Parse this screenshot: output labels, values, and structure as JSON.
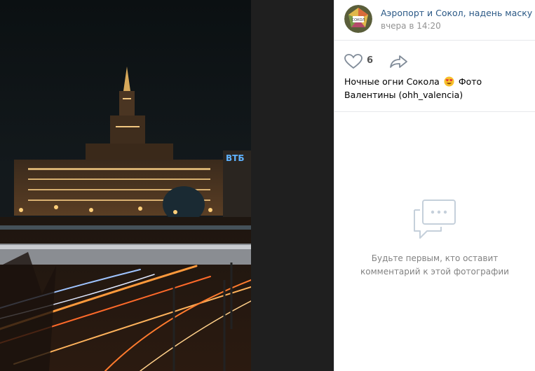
{
  "post": {
    "author_name": "Аэропорт и Сокол, надень маску",
    "time": "вчера в 14:20",
    "avatar_icon": "community-logo-icon"
  },
  "actions": {
    "like_count": "6",
    "like_icon": "heart-icon",
    "share_icon": "share-arrow-icon"
  },
  "caption": {
    "text_before_emoji": "Ночные огни Сокола",
    "emoji": "heart-eyes-emoji",
    "text_after_emoji": "Фото Валентины (ohh_valencia)"
  },
  "comments": {
    "empty_line1": "Будьте первым, кто оставит",
    "empty_line2": "комментарий к этой фотографии",
    "icon": "comments-icon"
  },
  "photo": {
    "building_sign": "ВТБ",
    "description_icon": "night-city-photo"
  },
  "colors": {
    "link": "#2a5885",
    "muted": "#939393",
    "viewer_bg": "#1f1f1f"
  }
}
